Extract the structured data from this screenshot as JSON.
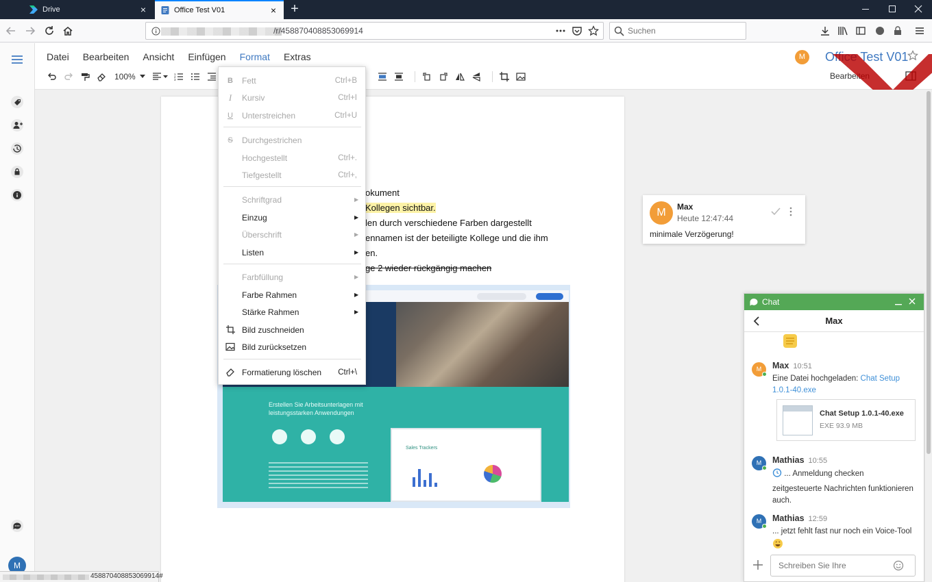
{
  "browser": {
    "tabs": [
      {
        "title": "Drive",
        "active": false
      },
      {
        "title": "Office Test V01",
        "active": true
      }
    ],
    "url_visible": "/r/458870408853069914",
    "search_placeholder": "Suchen",
    "status_url": "458870408853069914#"
  },
  "app": {
    "menu": [
      "Datei",
      "Bearbeiten",
      "Ansicht",
      "Einfügen",
      "Format",
      "Extras"
    ],
    "open_menu": "Format",
    "zoom": "100%",
    "doc_title": "Office Test V01",
    "user_initial": "M",
    "edit_label": "Bearbeiten",
    "accent_color": "#3f79c1"
  },
  "document": {
    "lines": [
      {
        "text": "okument",
        "style": "normal"
      },
      {
        "text": "Kollegen sichtbar.",
        "style": "highlight"
      },
      {
        "text": "len durch verschiedene Farben dargestellt",
        "style": "normal"
      },
      {
        "text": "ennamen ist der beteiligte Kollege und die ihm",
        "style": "normal"
      },
      {
        "text": "en.",
        "style": "normal"
      },
      {
        "text": "ge 2 wieder rückgängig machen",
        "style": "strike"
      }
    ],
    "image": {
      "heading": "Erstellen Sie Arbeitsunterlagen mit leistungsstarken Anwendungen",
      "sheet_title": "Sales Trackers",
      "teal_color": "#2fb2a6"
    }
  },
  "format_menu": {
    "items": [
      {
        "label": "Fett",
        "shortcut": "Ctrl+B",
        "icon": "bold-icon",
        "enabled": false,
        "submenu": false
      },
      {
        "label": "Kursiv",
        "shortcut": "Ctrl+I",
        "icon": "italic-icon",
        "enabled": false,
        "submenu": false
      },
      {
        "label": "Unterstreichen",
        "shortcut": "Ctrl+U",
        "icon": "underline-icon",
        "enabled": false,
        "submenu": false
      },
      {
        "label": "Durchgestrichen",
        "shortcut": "",
        "icon": "strikethrough-icon",
        "enabled": false,
        "submenu": false
      },
      {
        "label": "Hochgestellt",
        "shortcut": "Ctrl+.",
        "icon": "",
        "enabled": false,
        "submenu": false
      },
      {
        "label": "Tiefgestellt",
        "shortcut": "Ctrl+,",
        "icon": "",
        "enabled": false,
        "submenu": false
      },
      {
        "label": "Schriftgrad",
        "shortcut": "",
        "icon": "",
        "enabled": false,
        "submenu": true
      },
      {
        "label": "Einzug",
        "shortcut": "",
        "icon": "",
        "enabled": true,
        "submenu": true
      },
      {
        "label": "Überschrift",
        "shortcut": "",
        "icon": "",
        "enabled": false,
        "submenu": true
      },
      {
        "label": "Listen",
        "shortcut": "",
        "icon": "",
        "enabled": true,
        "submenu": true
      },
      {
        "label": "Farbfüllung",
        "shortcut": "",
        "icon": "",
        "enabled": false,
        "submenu": true
      },
      {
        "label": "Farbe Rahmen",
        "shortcut": "",
        "icon": "",
        "enabled": true,
        "submenu": true
      },
      {
        "label": "Stärke Rahmen",
        "shortcut": "",
        "icon": "",
        "enabled": true,
        "submenu": true
      },
      {
        "label": "Bild zuschneiden",
        "shortcut": "",
        "icon": "crop-icon",
        "enabled": true,
        "submenu": false
      },
      {
        "label": "Bild zurücksetzen",
        "shortcut": "",
        "icon": "image-reset-icon",
        "enabled": true,
        "submenu": false
      },
      {
        "label": "Formatierung löschen",
        "shortcut": "Ctrl+\\",
        "icon": "eraser-icon",
        "enabled": true,
        "submenu": false
      }
    ]
  },
  "comment": {
    "initial": "M",
    "author": "Max",
    "time": "Heute 12:47:44",
    "text": "minimale Verzögerung!"
  },
  "chat": {
    "title": "Chat",
    "partner": "Max",
    "accent_color": "#54a856",
    "messages": [
      {
        "author": "Max",
        "time": "10:51",
        "initial": "M",
        "avatar_color": "#f29d38",
        "text": "Eine Datei hochgeladen: ",
        "link": "Chat Setup 1.0.1-40.exe"
      },
      {
        "author": "Mathias",
        "time": "10:55",
        "initial": "M",
        "avatar_color": "#2f71b5",
        "text": "... Anmeldung checken",
        "text2": "zeitgesteuerte Nachrichten funktionieren auch."
      },
      {
        "author": "Mathias",
        "time": "12:59",
        "initial": "M",
        "avatar_color": "#2f71b5",
        "text": "... jetzt fehlt fast nur noch ein Voice-Tool"
      }
    ],
    "file": {
      "name": "Chat Setup 1.0.1-40.exe",
      "size": "EXE 93.9 MB"
    },
    "input_placeholder": "Schreiben Sie Ihre"
  }
}
